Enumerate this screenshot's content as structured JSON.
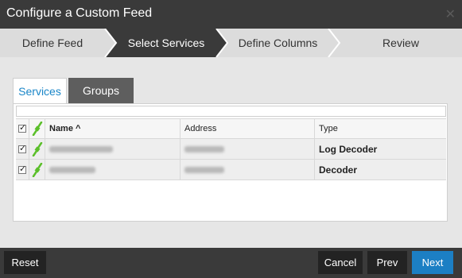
{
  "dialog": {
    "title": "Configure a Custom Feed",
    "close_icon": "close-icon"
  },
  "wizard": {
    "steps": [
      {
        "label": "Define Feed",
        "active": false
      },
      {
        "label": "Select Services",
        "active": true
      },
      {
        "label": "Define Columns",
        "active": false
      },
      {
        "label": "Review",
        "active": false
      }
    ]
  },
  "tabs": [
    {
      "label": "Services",
      "selected": true
    },
    {
      "label": "Groups",
      "selected": false
    }
  ],
  "filter": {
    "value": "",
    "placeholder": ""
  },
  "grid": {
    "columns": {
      "name": "Name ^",
      "address": "Address",
      "type": "Type"
    },
    "rows": [
      {
        "checked": true,
        "type": "Log Decoder"
      },
      {
        "checked": true,
        "type": "Decoder"
      }
    ]
  },
  "footer": {
    "reset": "Reset",
    "cancel": "Cancel",
    "prev": "Prev",
    "next": "Next"
  },
  "colors": {
    "accent": "#1c7fc4",
    "plug_green": "#5bbf2a",
    "active_step": "#3a3a3a"
  }
}
